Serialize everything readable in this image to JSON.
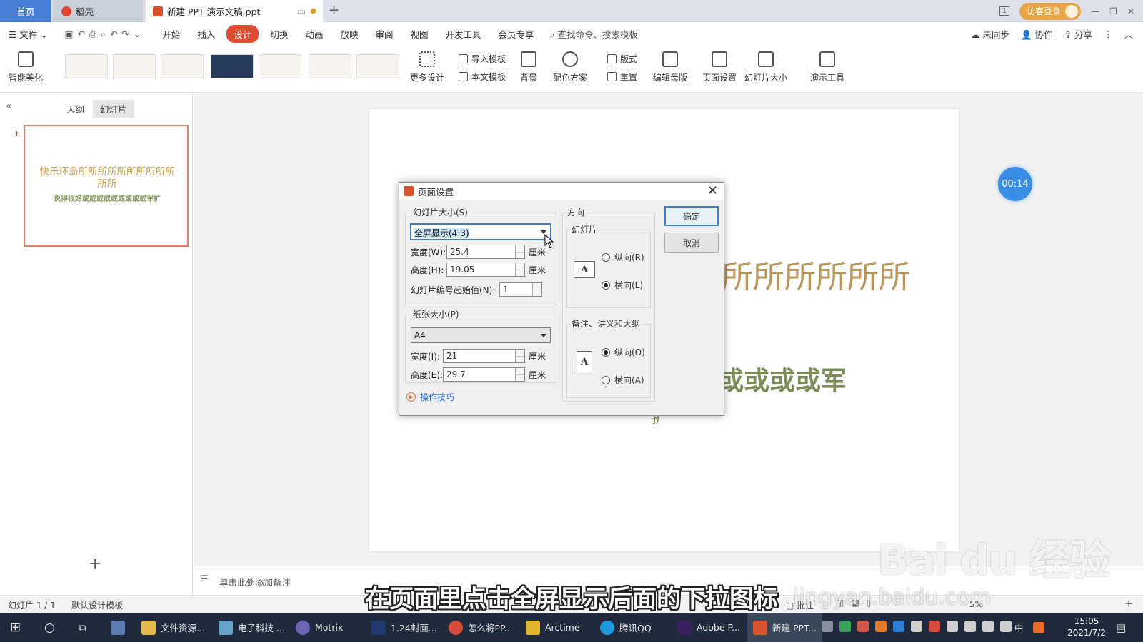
{
  "titlebar": {
    "home_tab": "首页",
    "daoke_tab": "稻壳",
    "doc_tab": "新建 PPT 演示文稿.ppt",
    "login_label": "访客登录",
    "window_count": "1"
  },
  "menu": {
    "file": "文件",
    "items": [
      "开始",
      "插入",
      "设计",
      "切换",
      "动画",
      "放映",
      "审阅",
      "视图",
      "开发工具",
      "会员专享"
    ],
    "search": "查找命令、搜索模板",
    "sync": "未同步",
    "collab": "协作",
    "share": "分享"
  },
  "ribbon": {
    "smart": "智能美化",
    "more_design": "更多设计",
    "import_template": "导入模板",
    "text_template": "本文模板",
    "background": "背景",
    "color_scheme": "配色方案",
    "layout": "版式",
    "reset": "重置",
    "edit_master": "编辑母版",
    "page_setup": "页面设置",
    "slide_size": "幻灯片大小",
    "present_tools": "演示工具"
  },
  "leftpanel": {
    "outline_tab": "大纲",
    "slides_tab": "幻灯片",
    "slide_number": "1",
    "thumb_title": "快乐环岛所所所所所所所所所所所所",
    "thumb_sub": "说得很好或或或或或或或或或军扩"
  },
  "slide": {
    "title_visible": "所所所所所所",
    "sub_visible": "或或或或军",
    "fragment": "扩"
  },
  "timer": "00:14",
  "notes_placeholder": "单击此处添加备注",
  "status": {
    "slide_count": "幻灯片 1 / 1",
    "template": "默认设计模板",
    "annotate": "批注",
    "zoom": "5%"
  },
  "subtitle": "在页面里点击全屏显示后面的下拉图标",
  "watermark": {
    "brand": "Bai du 经验",
    "url": "jingyan.baidu.com"
  },
  "dialog": {
    "title": "页面设置",
    "slide_size_group": "幻灯片大小(S)",
    "slide_size_value": "全屏显示(4:3)",
    "width_label": "宽度(W):",
    "width_value": "25.4",
    "height_label": "高度(H):",
    "height_value": "19.05",
    "unit": "厘米",
    "start_label": "幻灯片编号起始值(N):",
    "start_value": "1",
    "paper_group": "纸张大小(P)",
    "paper_value": "A4",
    "pwidth_label": "宽度(I):",
    "pwidth_value": "21",
    "pheight_label": "高度(E):",
    "pheight_value": "29.7",
    "tips": "操作技巧",
    "orientation_group": "方向",
    "slides_sub": "幻灯片",
    "portrait_r": "纵向(R)",
    "landscape_l": "横向(L)",
    "notes_sub": "备注、讲义和大纲",
    "portrait_o": "纵向(O)",
    "landscape_a": "横向(A)",
    "ok": "确定",
    "cancel": "取消"
  },
  "taskbar": {
    "items": [
      "文件资源...",
      "电子科技 ...",
      "Motrix",
      "1.24封面...",
      "怎么将PP...",
      "Arctime",
      "腾讯QQ",
      "Adobe P...",
      "新建 PPT..."
    ],
    "ime": "中",
    "time": "15:05",
    "date": "2021/7/2"
  }
}
